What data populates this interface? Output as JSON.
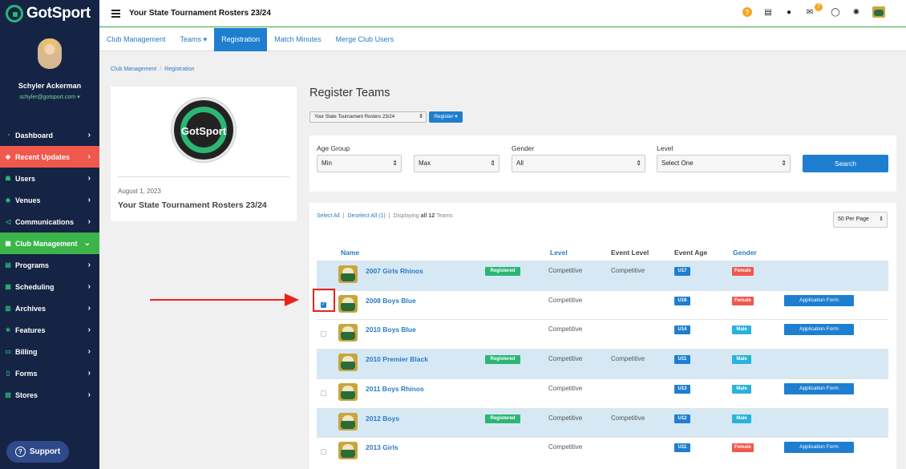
{
  "brand": {
    "name": "GotSport"
  },
  "user": {
    "name": "Schyler Ackerman",
    "email": "schyler@gotsport.com"
  },
  "sidebar": {
    "items": [
      {
        "label": "Dashboard",
        "icon": "dashboard-icon"
      },
      {
        "label": "Recent Updates",
        "icon": "bell-icon",
        "active": "red"
      },
      {
        "label": "Users",
        "icon": "users-icon"
      },
      {
        "label": "Venues",
        "icon": "venue-icon"
      },
      {
        "label": "Communications",
        "icon": "megaphone-icon"
      },
      {
        "label": "Club Management",
        "icon": "club-icon",
        "active": "green"
      },
      {
        "label": "Programs",
        "icon": "programs-icon"
      },
      {
        "label": "Scheduling",
        "icon": "calendar-icon"
      },
      {
        "label": "Archives",
        "icon": "archive-icon"
      },
      {
        "label": "Features",
        "icon": "star-icon"
      },
      {
        "label": "Billing",
        "icon": "credit-card-icon"
      },
      {
        "label": "Forms",
        "icon": "document-icon"
      },
      {
        "label": "Stores",
        "icon": "store-icon"
      }
    ],
    "support_label": "Support"
  },
  "topbar": {
    "title": "Your State Tournament Rosters 23/24",
    "notification_count": "7"
  },
  "tabs": [
    {
      "label": "Club Management"
    },
    {
      "label": "Teams ▾"
    },
    {
      "label": "Registration",
      "active": true
    },
    {
      "label": "Match Minutes"
    },
    {
      "label": "Merge Club Users"
    }
  ],
  "breadcrumb": {
    "items": [
      "Club Management",
      "Registration"
    ]
  },
  "event": {
    "logo_text": "GotSport",
    "date": "August 1, 2023",
    "title": "Your State Tournament Rosters 23/24"
  },
  "register": {
    "heading": "Register Teams",
    "event_select": "Your State Tournament Rosters 23/24",
    "register_button": "Register ▾"
  },
  "filters": {
    "age_group_label": "Age Group",
    "min_value": "Min",
    "max_value": "Max",
    "gender_label": "Gender",
    "gender_value": "All",
    "level_label": "Level",
    "level_value": "Select One",
    "search_button": "Search"
  },
  "list": {
    "select_all": "Select All",
    "deselect_all": "Deselect All (1)",
    "displaying_prefix": "Displaying",
    "displaying_bold": "all 12",
    "displaying_suffix": "Teams",
    "per_page": "50 Per Page",
    "columns": {
      "name": "Name",
      "level": "Level",
      "event_level": "Event Level",
      "event_age": "Event Age",
      "gender": "Gender"
    }
  },
  "teams": [
    {
      "name": "2007 Girls Rhinos",
      "registered": true,
      "registered_label": "Registered",
      "level": "Competitive",
      "event_level": "Competitive",
      "age": "U17",
      "gender": "Female",
      "checked": false,
      "app_form": ""
    },
    {
      "name": "2008 Boys Blue",
      "registered": false,
      "registered_label": "",
      "level": "Competitive",
      "event_level": "",
      "age": "U16",
      "gender": "Female",
      "checked": true,
      "app_form": "Application Form"
    },
    {
      "name": "2010 Boys Blue",
      "registered": false,
      "registered_label": "",
      "level": "Competitive",
      "event_level": "",
      "age": "U14",
      "gender": "Male",
      "checked": false,
      "app_form": "Application Form"
    },
    {
      "name": "2010 Premier Black",
      "registered": true,
      "registered_label": "Registered",
      "level": "Competitive",
      "event_level": "Competitive",
      "age": "U11",
      "gender": "Male",
      "checked": false,
      "app_form": ""
    },
    {
      "name": "2011 Boys Rhinos",
      "registered": false,
      "registered_label": "",
      "level": "Competitive",
      "event_level": "",
      "age": "U13",
      "gender": "Male",
      "checked": false,
      "app_form": "Application Form"
    },
    {
      "name": "2012 Boys",
      "registered": true,
      "registered_label": "Registered",
      "level": "Competitive",
      "event_level": "Competitive",
      "age": "U12",
      "gender": "Male",
      "checked": false,
      "app_form": ""
    },
    {
      "name": "2013 Girls",
      "registered": false,
      "registered_label": "",
      "level": "Competitive",
      "event_level": "",
      "age": "U11",
      "gender": "Female",
      "checked": false,
      "app_form": "Application Form"
    }
  ],
  "colors": {
    "sidebar_bg": "#152444",
    "accent_blue": "#1e7fd0",
    "brand_green": "#2bb673",
    "alert_red": "#f0584e",
    "annotation_red": "#e8231c"
  }
}
